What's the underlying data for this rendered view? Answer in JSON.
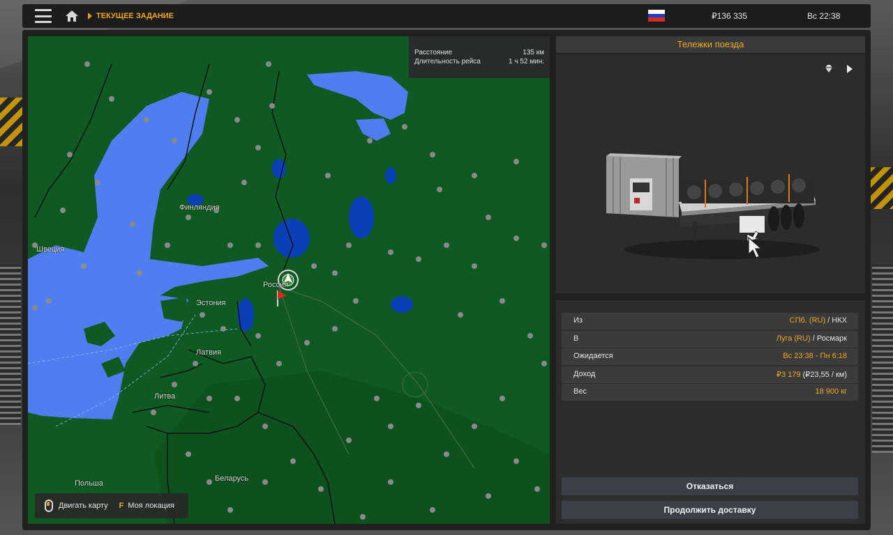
{
  "header": {
    "breadcrumb": "ТЕКУЩЕЕ ЗАДАНИЕ",
    "money": "₽136 335",
    "clock": "Вс 22:38",
    "flag_colors": [
      "#ffffff",
      "#1c3fbf",
      "#d52b1e"
    ],
    "menu_icon": "hamburger-icon",
    "home_icon": "home-icon"
  },
  "map": {
    "trip": {
      "distance_label": "Расстояние",
      "distance_value": "135 км",
      "duration_label": "Длительность рейса",
      "duration_value": "1 ч 52 мин."
    },
    "countries": {
      "finland": "Финляндия",
      "sweden": "Швеция",
      "russia": "Россия",
      "estonia": "Эстония",
      "latvia": "Латвия",
      "lithuania": "Литва",
      "poland": "Польша",
      "belarus": "Беларусь"
    },
    "legend": {
      "move_map": "Двигать карту",
      "key_f": "F",
      "my_location": "Моя локация"
    },
    "colors": {
      "land": "#0f5a22",
      "water": "#4f7ef0",
      "lake": "#0a3fb8"
    }
  },
  "cargo": {
    "title": "Тележки поезда",
    "gem_icon": "diamond-icon",
    "next_icon": "play-arrow-icon"
  },
  "details": {
    "from_label": "Из",
    "from_city": "СПб. (RU)",
    "from_sep": " / ",
    "from_company": "НКХ",
    "to_label": "В",
    "to_city": "Луга (RU)",
    "to_sep": " / ",
    "to_company": "Росмарк",
    "expected_label": "Ожидается",
    "expected_value": "Вс 23:38 - Пн 6:18",
    "income_label": "Доход",
    "income_value": "₽3 179",
    "income_rate": " (₽23,55 / км)",
    "weight_label": "Вес",
    "weight_value": "18 900 кг"
  },
  "actions": {
    "cancel": "Отказаться",
    "continue": "Продолжить доставку"
  },
  "accent": "#f0a81e"
}
